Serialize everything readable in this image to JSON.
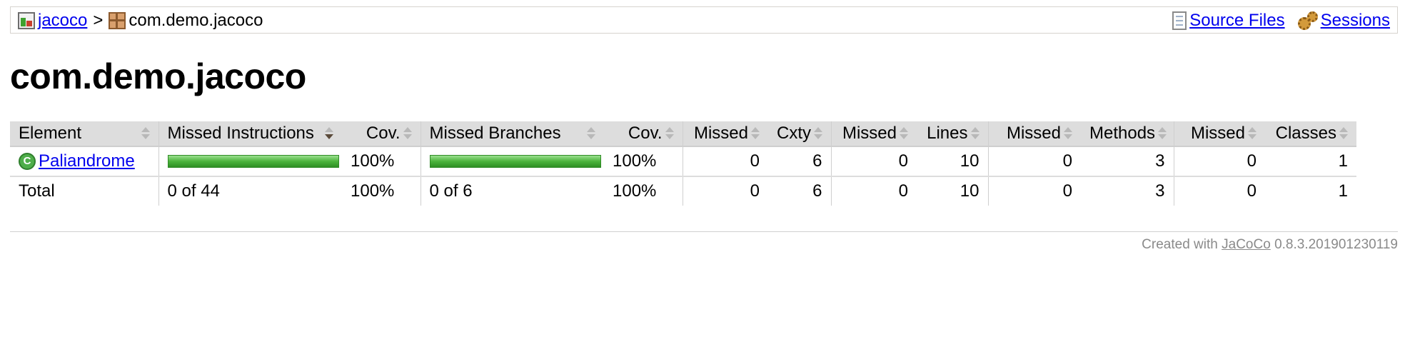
{
  "breadcrumb": {
    "root_label": "jacoco",
    "separator": ">",
    "current_label": "com.demo.jacoco",
    "source_files_label": "Source Files",
    "sessions_label": "Sessions"
  },
  "page_title": "com.demo.jacoco",
  "table": {
    "headers": {
      "element": "Element",
      "missed_instructions": "Missed Instructions",
      "cov1": "Cov.",
      "missed_branches": "Missed Branches",
      "cov2": "Cov.",
      "missed_cxty": "Missed",
      "cxty": "Cxty",
      "missed_lines": "Missed",
      "lines": "Lines",
      "missed_methods": "Missed",
      "methods": "Methods",
      "missed_classes": "Missed",
      "classes": "Classes"
    },
    "rows": [
      {
        "element": "Paliandrome",
        "instructions_coverage_fraction": 1.0,
        "cov_instructions": "100%",
        "branches_coverage_fraction": 1.0,
        "cov_branches": "100%",
        "missed_cxty": "0",
        "cxty": "6",
        "missed_lines": "0",
        "lines": "10",
        "missed_methods": "0",
        "methods": "3",
        "missed_classes": "0",
        "classes": "1"
      }
    ],
    "total": {
      "label": "Total",
      "missed_instructions": "0 of 44",
      "cov_instructions": "100%",
      "missed_branches": "0 of 6",
      "cov_branches": "100%",
      "missed_cxty": "0",
      "cxty": "6",
      "missed_lines": "0",
      "lines": "10",
      "missed_methods": "0",
      "methods": "3",
      "missed_classes": "0",
      "classes": "1"
    }
  },
  "footer": {
    "prefix": "Created with",
    "link": "JaCoCo",
    "version": "0.8.3.201901230119"
  },
  "colors": {
    "link": "#0000ee",
    "bar_green": "#4bb33b",
    "header_bg": "#dddddd"
  }
}
